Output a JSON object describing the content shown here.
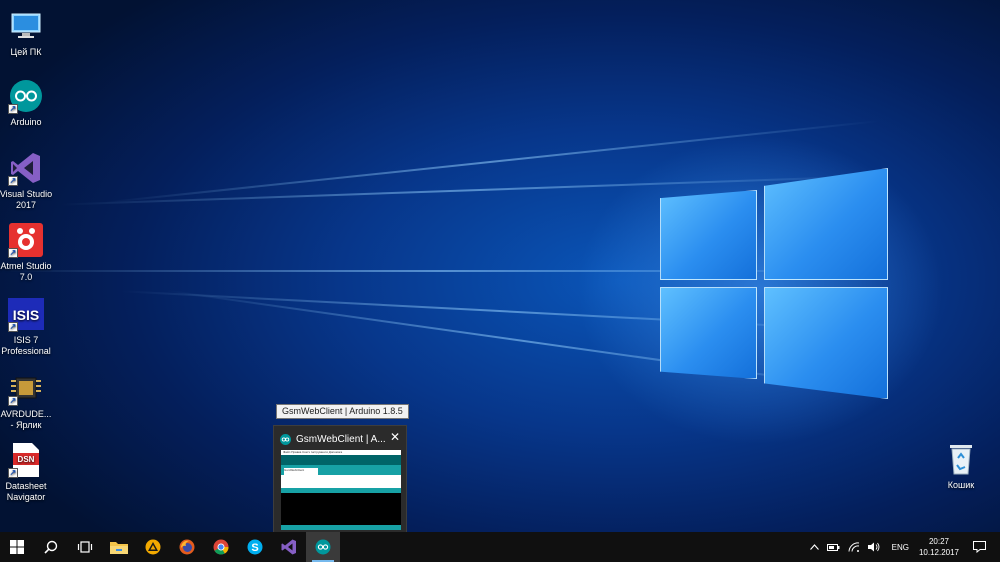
{
  "desktop": {
    "icons": [
      {
        "label": "Цей ПК"
      },
      {
        "label": "Arduino"
      },
      {
        "label": "Visual Studio 2017"
      },
      {
        "label": "Atmel Studio 7.0"
      },
      {
        "label": "ISIS 7 Professional",
        "badge": "ISIS"
      },
      {
        "label": "AVRDUDE... - Ярлик"
      },
      {
        "label": "Datasheet Navigator",
        "badge": "DSN"
      },
      {
        "label": "Кошик"
      }
    ]
  },
  "preview": {
    "tooltip": "GsmWebClient | Arduino 1.8.5",
    "title": "GsmWebClient | A...",
    "close": "✕",
    "thumb_menu": "Файл Правка Скетч Інструменти Допомога",
    "thumb_tab": "GsmWebClient"
  },
  "taskbar": {
    "language": "ENG",
    "time": "20:27",
    "date": "10.12.2017"
  },
  "colors": {
    "accent": "#76b9ed",
    "arduino_teal": "#00979c"
  }
}
